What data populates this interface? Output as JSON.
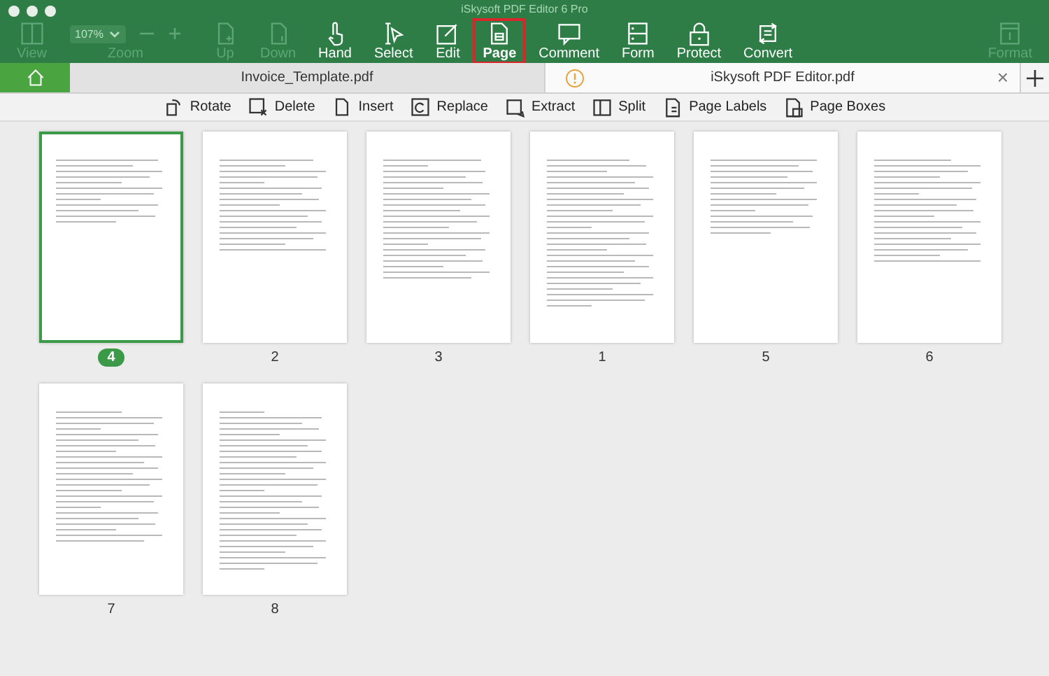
{
  "window": {
    "title": "iSkysoft PDF Editor 6 Pro"
  },
  "toolbar": [
    {
      "kind": "view",
      "label": "View",
      "disabled": true,
      "selected": false
    },
    {
      "kind": "zoom",
      "label": "Zoom",
      "value": "107%",
      "disabled": true,
      "selected": false
    },
    {
      "kind": "up",
      "label": "Up",
      "disabled": true,
      "selected": false
    },
    {
      "kind": "down",
      "label": "Down",
      "disabled": true,
      "selected": false
    },
    {
      "kind": "hand",
      "label": "Hand",
      "disabled": false,
      "selected": false
    },
    {
      "kind": "select",
      "label": "Select",
      "disabled": false,
      "selected": false
    },
    {
      "kind": "edit",
      "label": "Edit",
      "disabled": false,
      "selected": false
    },
    {
      "kind": "page",
      "label": "Page",
      "disabled": false,
      "selected": true
    },
    {
      "kind": "comment",
      "label": "Comment",
      "disabled": false,
      "selected": false
    },
    {
      "kind": "form",
      "label": "Form",
      "disabled": false,
      "selected": false
    },
    {
      "kind": "protect",
      "label": "Protect",
      "disabled": false,
      "selected": false
    },
    {
      "kind": "convert",
      "label": "Convert",
      "disabled": false,
      "selected": false
    },
    {
      "kind": "format",
      "label": "Format",
      "disabled": true,
      "selected": false
    }
  ],
  "tabs": [
    {
      "kind": "document",
      "label": "Invoice_Template.pdf",
      "selected": false
    },
    {
      "kind": "warning",
      "label": "iSkysoft PDF Editor.pdf",
      "selected": true,
      "close": "×"
    }
  ],
  "page_tools": [
    {
      "kind": "rotate",
      "label": "Rotate"
    },
    {
      "kind": "delete",
      "label": "Delete"
    },
    {
      "kind": "insert",
      "label": "Insert"
    },
    {
      "kind": "replace",
      "label": "Replace"
    },
    {
      "kind": "extract",
      "label": "Extract"
    },
    {
      "kind": "split",
      "label": "Split"
    },
    {
      "kind": "labels",
      "label": "Page Labels"
    },
    {
      "kind": "boxes",
      "label": "Page Boxes"
    }
  ],
  "pages": [
    {
      "label": "4",
      "selected": true
    },
    {
      "label": "2",
      "selected": false
    },
    {
      "label": "3",
      "selected": false
    },
    {
      "label": "1",
      "selected": false
    },
    {
      "label": "5",
      "selected": false
    },
    {
      "label": "6",
      "selected": false
    },
    {
      "label": "7",
      "selected": false
    },
    {
      "label": "8",
      "selected": false
    }
  ]
}
